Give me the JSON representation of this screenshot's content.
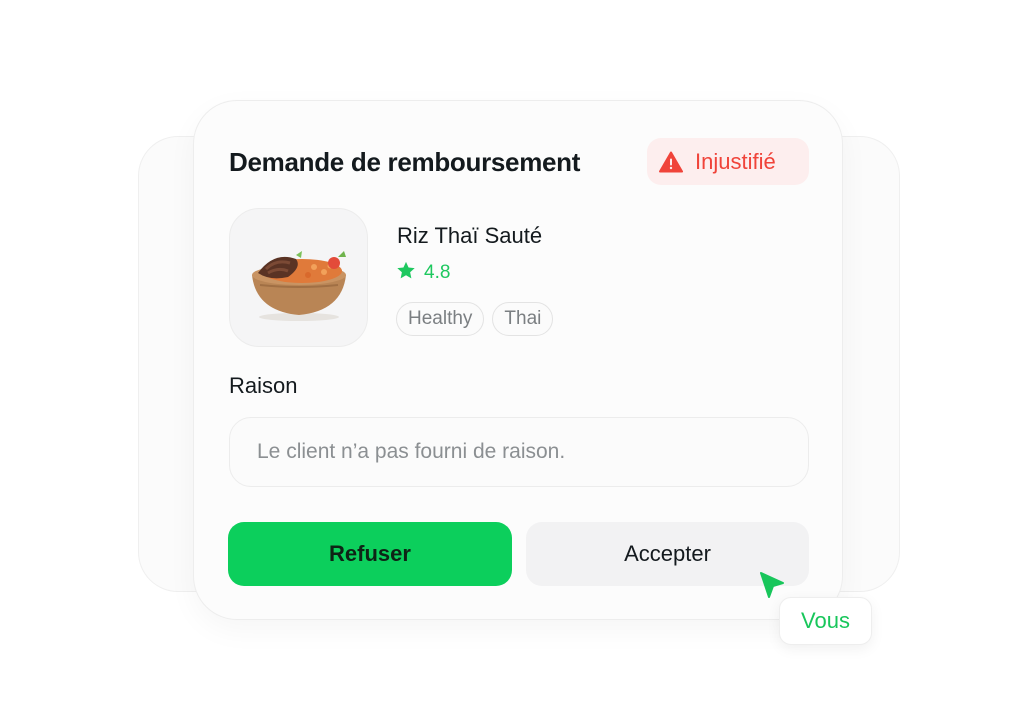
{
  "refund_request": {
    "title": "Demande de remboursement",
    "status_badge": {
      "label": "Injustifié",
      "icon": "warning-icon",
      "color": "#f0443a"
    },
    "dish": {
      "name": "Riz Thaï Sauté",
      "rating": "4.8",
      "rating_icon": "star-icon",
      "tags": [
        "Healthy",
        "Thai"
      ]
    },
    "reason": {
      "label": "Raison",
      "text": "Le client n’a pas fourni de raison."
    },
    "actions": {
      "refuse_label": "Refuser",
      "accept_label": "Accepter"
    }
  },
  "user_cursor": {
    "label": "Vous",
    "icon": "pointer-cursor-icon"
  },
  "colors": {
    "accent_green": "#0ccf5c",
    "danger_red": "#f0443a"
  }
}
